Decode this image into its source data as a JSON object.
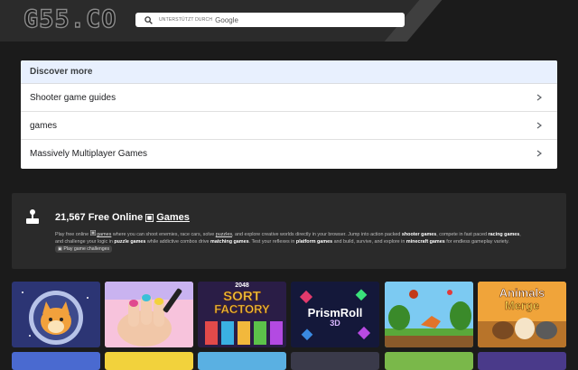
{
  "header": {
    "logo": "G55.CO",
    "search": {
      "powered_label": "UNTERSTÜTZT DURCH",
      "brand_label": "Google"
    }
  },
  "discover": {
    "title": "Discover more",
    "items": [
      {
        "label": "Shooter game guides"
      },
      {
        "label": "games"
      },
      {
        "label": "Massively Multiplayer Games"
      }
    ]
  },
  "info": {
    "count": "21,567 Free Online",
    "games_link": "Games",
    "description": {
      "p1": "Play free online",
      "games": "games",
      "p2": "where you can shoot enemies, race cars, solve",
      "puzzles": "puzzles",
      "p3": ", and explore creative worlds directly in your browser. Jump into action packed",
      "shooter": "shooter games",
      "p4": ", compete in fast paced",
      "racing": "racing games",
      "p5": ", and challenge your logic in",
      "puzzle": "puzzle games",
      "p6": "while addictive combos drive",
      "matching": "matching games",
      "p7": ". Test your reflexes in",
      "platform": "platform games",
      "p8": "and build, survive, and explore in",
      "minecraft": "minecraft games",
      "p9": "for endless gameplay variety.",
      "chip": "Play game challenges"
    }
  },
  "games": [
    {
      "title": ""
    },
    {
      "title": ""
    },
    {
      "title_top": "2048",
      "title": "SORT",
      "title2": "FACTORY"
    },
    {
      "title": "PrismRoll",
      "title2": "3D"
    },
    {
      "title": ""
    },
    {
      "title": "Animals",
      "title2": "Merge"
    }
  ],
  "colors": {
    "header_bg": "#2b2b2b",
    "page_bg": "#1b1b1b",
    "panel_bg": "#2a2a2a",
    "discover_head": "#e8f0fe"
  }
}
